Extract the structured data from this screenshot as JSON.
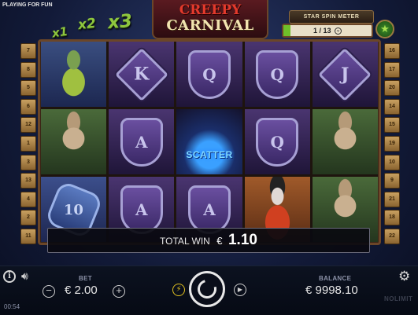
{
  "mode_label": "PLAYING FOR FUN",
  "multipliers": [
    "x1",
    "x2",
    "x3"
  ],
  "logo": {
    "line1": "CREEPY",
    "line2": "CARNIVAL"
  },
  "star_meter": {
    "title": "STAR SPIN METER",
    "progress": "1 / 13",
    "progress_fraction": 0.077,
    "chevron": "⌄",
    "button_icon": "star-icon"
  },
  "left_numbers": [
    "7",
    "8",
    "5",
    "6",
    "12",
    "1",
    "3",
    "13",
    "4",
    "2",
    "11"
  ],
  "right_numbers": [
    "16",
    "17",
    "20",
    "14",
    "15",
    "19",
    "10",
    "9",
    "21",
    "18",
    "22"
  ],
  "reels": [
    [
      "clown",
      "K",
      "Q",
      "Q",
      "J"
    ],
    [
      "strongman",
      "A",
      "SCATTER",
      "Q",
      "strongman"
    ],
    [
      "10",
      "A",
      "A",
      "lady",
      "strongman"
    ]
  ],
  "total_win": {
    "label": "TOTAL WIN",
    "currency": "€",
    "value": "1.10"
  },
  "bottom": {
    "bet_label": "BET",
    "bet_value": "€ 2.00",
    "balance_label": "BALANCE",
    "balance_value": "€ 9998.10",
    "clock": "00:54",
    "brand": "NOLIMIT"
  },
  "colors": {
    "accent_green": "#8ec63f",
    "logo_red": "#e33a2c",
    "frame_brown": "#6b4628"
  }
}
